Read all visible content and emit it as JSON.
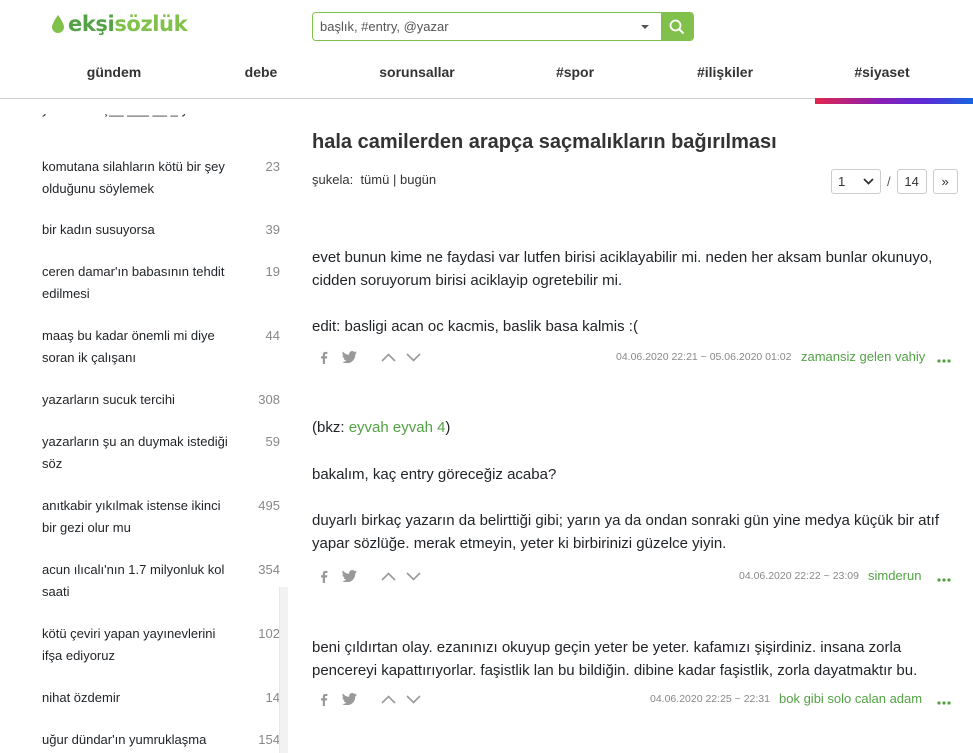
{
  "header": {
    "logo_prefix": "ekşi",
    "logo_suffix": "sözlük",
    "search_placeholder": "başlık, #entry, @yazar",
    "nav": [
      "gündem",
      "debe",
      "sorunsallar",
      "#spor",
      "#ilişkiler",
      "#siyaset"
    ]
  },
  "sidebar": {
    "items": [
      {
        "title": "komutana silahların kötü bir şey olduğunu söylemek",
        "count": "23"
      },
      {
        "title": "bir kadın susuyorsa",
        "count": "39"
      },
      {
        "title": "ceren damar'ın babasının tehdit edilmesi",
        "count": "19"
      },
      {
        "title": "maaş bu kadar önemli mi diye soran ik çalışanı",
        "count": "44"
      },
      {
        "title": "yazarların sucuk tercihi",
        "count": "308"
      },
      {
        "title": "yazarların şu an duymak istediği söz",
        "count": "59"
      },
      {
        "title": "anıtkabir yıkılmak istense ikinci bir gezi olur mu",
        "count": "495"
      },
      {
        "title": "acun ılıcalı'nın 1.7 milyonluk kol saati",
        "count": "354"
      },
      {
        "title": "kötü çeviri yapan yayınevlerini ifşa ediyoruz",
        "count": "102"
      },
      {
        "title": "nihat özdemir",
        "count": "14"
      },
      {
        "title": "uğur dündar'ın yumruklaşma",
        "count": "154"
      }
    ]
  },
  "topic": {
    "title": "hala camilerden arapça saçmalıkların bağırılması",
    "sukela_label": "şukela:",
    "filter_all": "tümü",
    "filter_sep": "|",
    "filter_today": "bugün",
    "page_current": "1",
    "page_sep": "/",
    "page_total": "14",
    "page_next": "»"
  },
  "entries": [
    {
      "paragraphs": [
        "evet bunun kime ne faydasi var lutfen birisi aciklayabilir mi. neden her aksam bunlar okunuyo, cidden soruyorum birisi aciklayip ogretebilir mi.",
        "edit: basligi acan oc kacmis, baslik basa kalmis :("
      ],
      "date": "04.06.2020 22:21 ~ 05.06.2020 01:02",
      "author": "zamansiz gelen vahiy"
    },
    {
      "bkz_prefix": "(bkz: ",
      "bkz_link": "eyvah eyvah 4",
      "bkz_suffix": ")",
      "paragraphs": [
        "bakalım, kaç entry göreceğiz acaba?",
        "duyarlı birkaç yazarın da belirttiği gibi; yarın ya da ondan sonraki gün yine medya küçük bir atıf yapar sözlüğe. merak etmeyin, yeter ki birbirinizi güzelce yiyin."
      ],
      "date": "04.06.2020 22:22 ~ 23:09",
      "author": "simderun"
    },
    {
      "paragraphs": [
        "beni çıldırtan olay. ezanınızı okuyup geçin yeter be yeter. kafamızı şişirdiniz. insana zorla pencereyi kapattırıyorlar. faşistlik lan bu bildiğin. dibine kadar faşistlik, zorla dayatmaktır bu."
      ],
      "date": "04.06.2020 22:25 ~ 22:31",
      "author": "bok gibi solo calan adam"
    }
  ],
  "colors": {
    "brand_green": "#81c14b",
    "link_green": "#53a245",
    "muted": "#888888"
  },
  "icons": [
    "drop-icon",
    "chevron-down-icon",
    "search-icon",
    "facebook-icon",
    "twitter-icon",
    "upvote-icon",
    "downvote-icon",
    "more-icon"
  ]
}
